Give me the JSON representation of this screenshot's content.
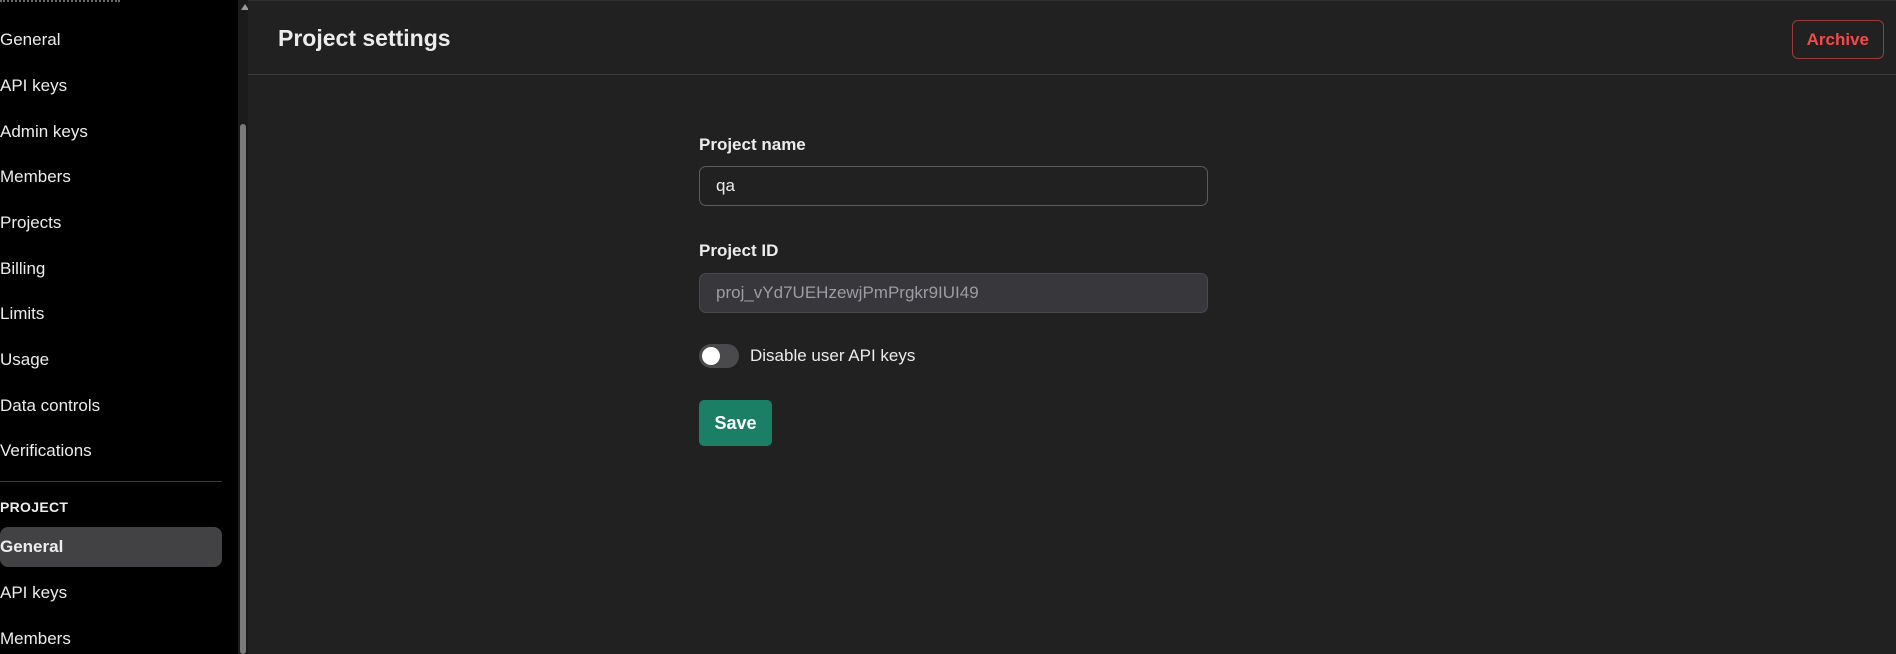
{
  "sidebar": {
    "org_items": [
      {
        "label": "General"
      },
      {
        "label": "API keys"
      },
      {
        "label": "Admin keys"
      },
      {
        "label": "Members"
      },
      {
        "label": "Projects"
      },
      {
        "label": "Billing"
      },
      {
        "label": "Limits"
      },
      {
        "label": "Usage"
      },
      {
        "label": "Data controls"
      },
      {
        "label": "Verifications"
      }
    ],
    "project_section_label": "PROJECT",
    "project_items": [
      {
        "label": "General",
        "active": true
      },
      {
        "label": "API keys"
      },
      {
        "label": "Members"
      }
    ]
  },
  "header": {
    "title": "Project settings",
    "archive_label": "Archive"
  },
  "form": {
    "project_name_label": "Project name",
    "project_name_value": "qa",
    "project_id_label": "Project ID",
    "project_id_value": "proj_vYd7UEHzewjPmPrgkr9IUI49",
    "disable_keys_label": "Disable user API keys",
    "disable_keys_enabled": false,
    "save_label": "Save"
  },
  "colors": {
    "accent": "#1a7f64",
    "danger": "#f04b4b",
    "sidebar_bg": "#000000",
    "main_bg": "#212122"
  }
}
